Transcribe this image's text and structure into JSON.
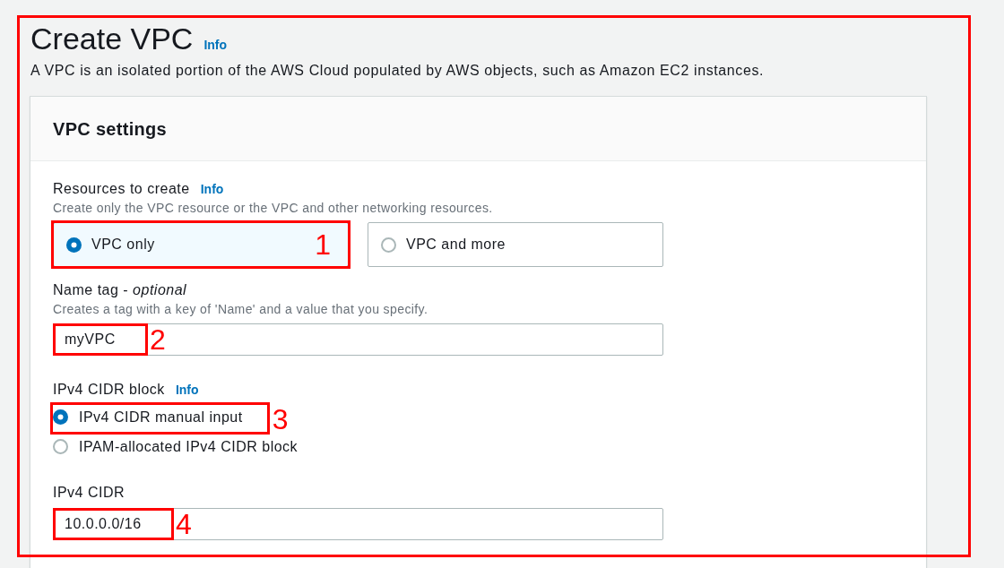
{
  "page": {
    "title": "Create VPC",
    "info_link": "Info",
    "description": "A VPC is an isolated portion of the AWS Cloud populated by AWS objects, such as Amazon EC2 instances."
  },
  "panel": {
    "title": "VPC settings",
    "fields": [
      {
        "kind": "tiles",
        "label": "Resources to create",
        "info_link": "Info",
        "hint": "Create only the VPC resource or the VPC and other networking resources.",
        "options": [
          {
            "label": "VPC only",
            "selected": true,
            "annotation": "1"
          },
          {
            "label": "VPC and more",
            "selected": false
          }
        ]
      },
      {
        "kind": "text",
        "label": "Name tag - *optional*",
        "hint": "Creates a tag with a key of 'Name' and a value that you specify.",
        "value": "myVPC",
        "annotation": "2"
      },
      {
        "kind": "radios",
        "label": "IPv4 CIDR block",
        "info_link": "Info",
        "options": [
          {
            "label": "IPv4 CIDR manual input",
            "selected": true,
            "annotation": "3"
          },
          {
            "label": "IPAM-allocated IPv4 CIDR block",
            "selected": false
          }
        ]
      },
      {
        "kind": "text",
        "label": "IPv4 CIDR",
        "value": "10.0.0.0/16",
        "annotation": "4"
      }
    ]
  }
}
